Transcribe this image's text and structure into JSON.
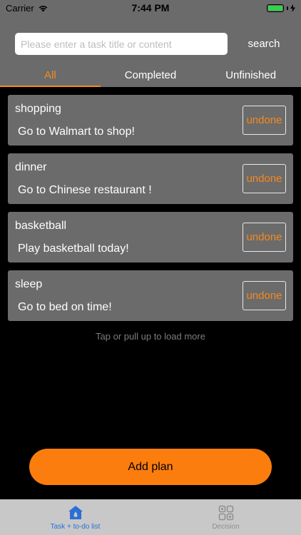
{
  "status_bar": {
    "carrier": "Carrier",
    "time": "7:44 PM"
  },
  "search": {
    "placeholder": "Please enter a task title or content",
    "value": "",
    "button_label": "search"
  },
  "tabs": [
    {
      "label": "All",
      "active": true
    },
    {
      "label": "Completed",
      "active": false
    },
    {
      "label": "Unfinished",
      "active": false
    }
  ],
  "tasks": [
    {
      "title": "shopping",
      "content": "Go to Walmart to shop!",
      "status": "undone"
    },
    {
      "title": "dinner",
      "content": "Go to Chinese restaurant !",
      "status": "undone"
    },
    {
      "title": "basketball",
      "content": "Play basketball today!",
      "status": "undone"
    },
    {
      "title": "sleep",
      "content": "Go to bed on time!",
      "status": "undone"
    }
  ],
  "load_more": "Tap or pull up to load more",
  "add_button_label": "Add plan",
  "tabbar": [
    {
      "label": "Task + to-do list",
      "icon": "home-icon",
      "active": true
    },
    {
      "label": "Decision",
      "icon": "grid-icon",
      "active": false
    }
  ],
  "colors": {
    "accent": "#f5891f",
    "panel": "#6b6b6b",
    "button": "#fb7d0e",
    "tab_active": "#2b6fd6"
  }
}
